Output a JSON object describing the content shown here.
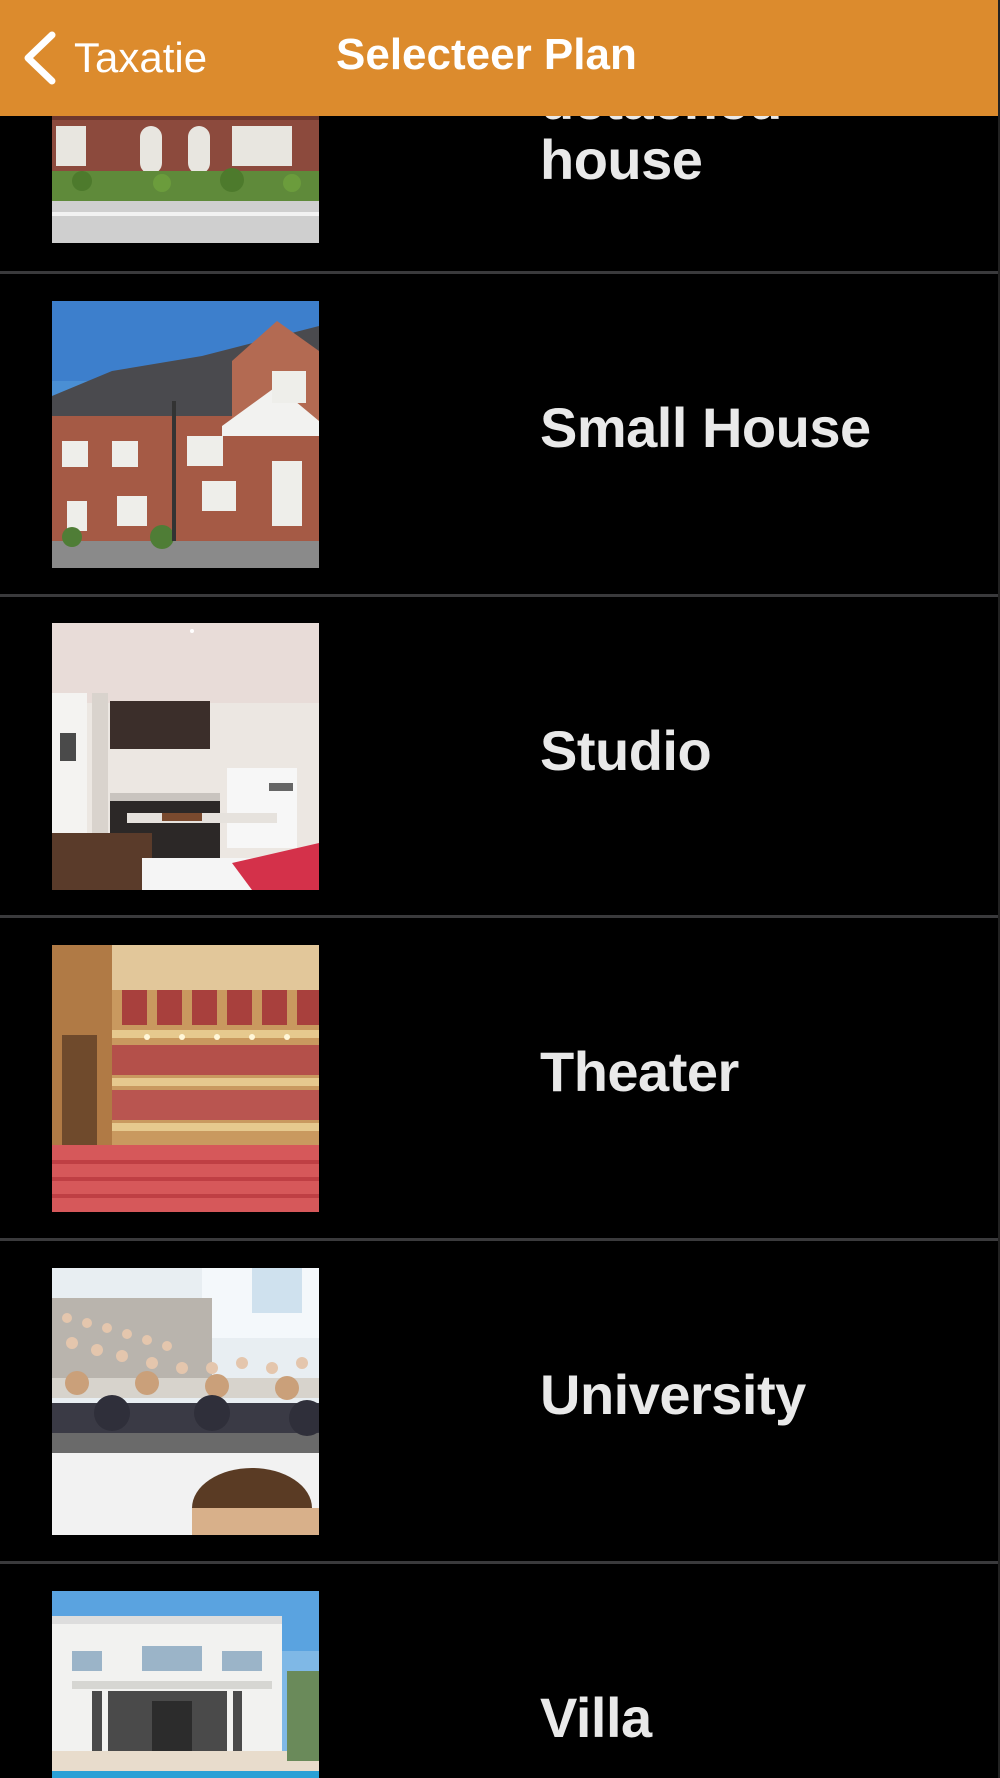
{
  "navbar": {
    "back_label": "Taxatie",
    "title": "Selecteer Plan",
    "background_color": "#dc8b2d"
  },
  "plans": [
    {
      "label_line1": "detached",
      "label_line2": "house",
      "image": "detached-house-photo"
    },
    {
      "label": "Small House",
      "image": "small-house-photo"
    },
    {
      "label": "Studio",
      "image": "studio-photo"
    },
    {
      "label": "Theater",
      "image": "theater-photo"
    },
    {
      "label": "University",
      "image": "university-photo"
    },
    {
      "label": "Villa",
      "image": "villa-photo"
    }
  ]
}
